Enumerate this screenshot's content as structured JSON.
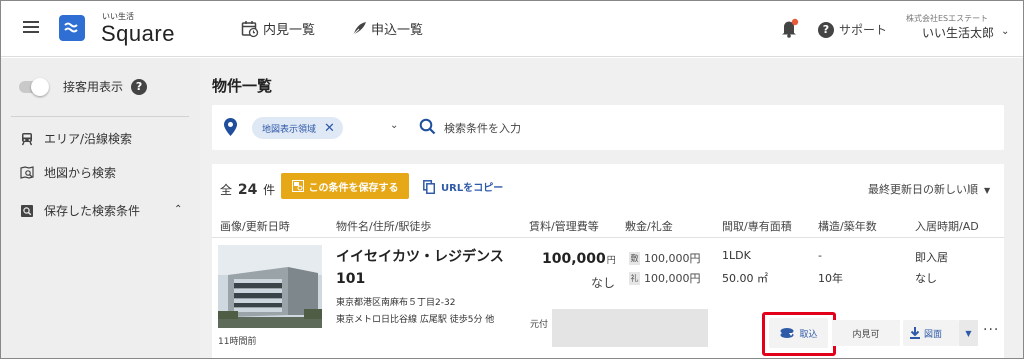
{
  "header": {
    "logo_small": "いい生活",
    "logo_big": "Square",
    "nav": [
      {
        "label": "内見一覧",
        "icon": "calendar-clock-icon"
      },
      {
        "label": "申込一覧",
        "icon": "pen-nib-icon"
      }
    ],
    "support_label": "サポート",
    "user_company": "株式会社ESエステート",
    "user_name": "いい生活太郎",
    "colors": {
      "brand": "#2f6fd4",
      "notification": "#e85a3c"
    }
  },
  "sidebar": {
    "toggle_label": "接客用表示",
    "items": [
      {
        "label": "エリア/沿線検索",
        "icon": "train-icon"
      },
      {
        "label": "地図から検索",
        "icon": "map-search-icon"
      },
      {
        "label": "保存した検索条件",
        "icon": "saved-search-icon"
      }
    ]
  },
  "main": {
    "title": "物件一覧",
    "search": {
      "chip_label": "地図表示領域",
      "placeholder": "検索条件を入力"
    },
    "results": {
      "count_prefix": "全",
      "count": "24",
      "count_suffix": "件",
      "save_label": "この条件を保存する",
      "copy_url_label": "URLをコピー",
      "sort_label": "最終更新日の新しい順",
      "columns": [
        "画像/更新日時",
        "物件名/住所/駅徒歩",
        "賃料/管理費等",
        "敷金/礼金",
        "間取/専有面積",
        "構造/築年数",
        "入居時期/AD"
      ],
      "row": {
        "updated": "11時間前",
        "name_line1": "イイセイカツ・レジデンス",
        "name_line2": "101",
        "address": "東京都港区南麻布５丁目2-32",
        "station": "東京メトロ日比谷線 広尾駅 徒歩5分 他",
        "rent": "100,000",
        "rent_unit": "円",
        "management": "なし",
        "deposit_tag": "敷",
        "deposit": "100,000円",
        "key_money_tag": "礼",
        "key_money": "100,000円",
        "layout": "1LDK",
        "area": "50.00 ㎡",
        "structure": "-",
        "age": "10年",
        "move_in": "即入居",
        "ad": "なし",
        "moto_label": "元付",
        "torikomi_label": "取込",
        "naiken_label": "内見可",
        "zumen_label": "図面",
        "more_label": "···"
      }
    },
    "highlight_color": "#e2001a"
  }
}
